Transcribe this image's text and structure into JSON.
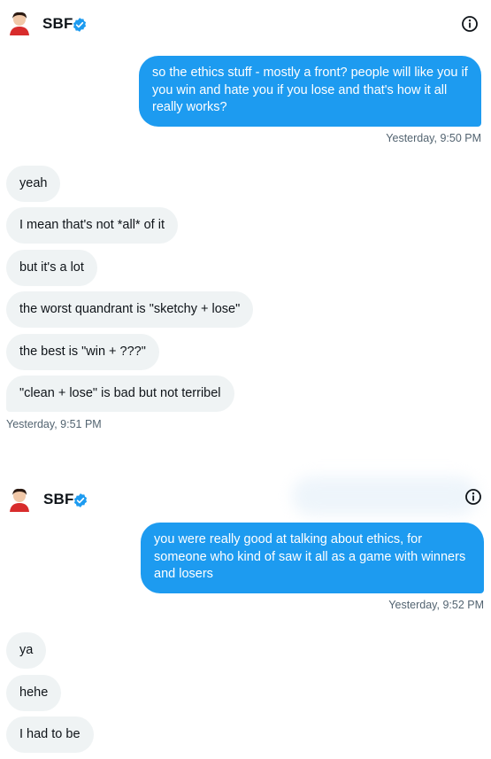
{
  "colors": {
    "accent": "#1d9bf0",
    "incoming_bubble": "#eff3f4",
    "timestamp": "#536471"
  },
  "conversations": [
    {
      "header": {
        "name": "SBF",
        "verified_icon": "verified-badge-icon",
        "info_icon": "info-icon"
      },
      "outgoing": {
        "text": "so the ethics stuff - mostly a front? people will like you if you win and hate you if you lose and that's how it all really works?",
        "timestamp": "Yesterday, 9:50 PM"
      },
      "incoming": [
        "yeah",
        "I mean that's not *all* of it",
        "but it's a lot",
        "the worst quandrant is \"sketchy + lose\"",
        "the best is \"win + ???\"",
        "\"clean + lose\" is bad but not terribel"
      ],
      "incoming_timestamp": "Yesterday, 9:51 PM"
    },
    {
      "header": {
        "name": "SBF",
        "verified_icon": "verified-badge-icon",
        "info_icon": "info-icon"
      },
      "outgoing": {
        "text": "you were really good at talking about ethics, for someone who kind of saw it all as a game with winners and losers",
        "timestamp": "Yesterday, 9:52 PM"
      },
      "incoming": [
        "ya",
        "hehe",
        "I had to be"
      ]
    }
  ]
}
